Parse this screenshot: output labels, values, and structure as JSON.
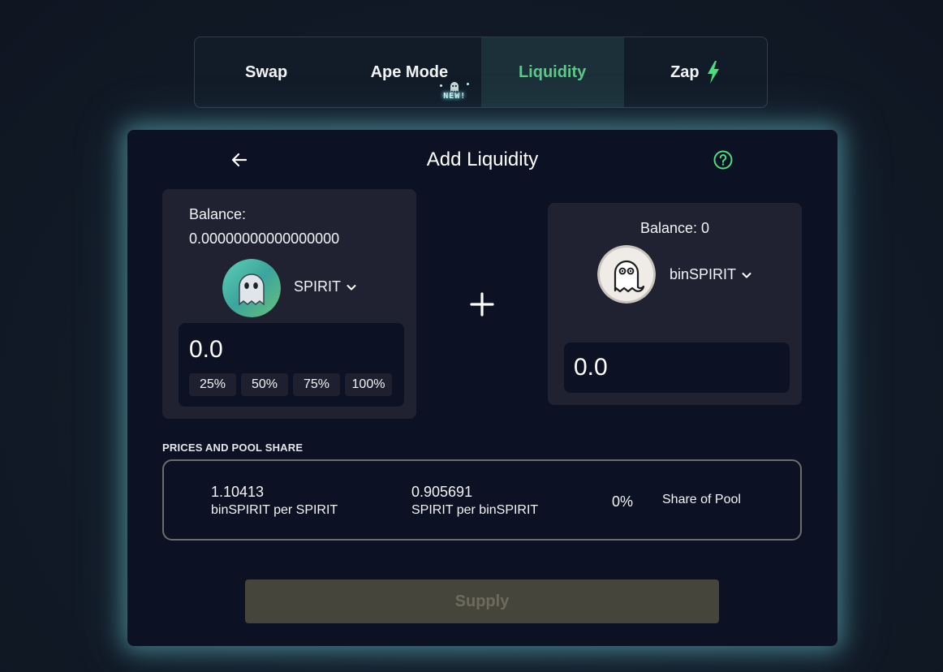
{
  "tabs": [
    {
      "label": "Swap"
    },
    {
      "label": "Ape Mode",
      "badge": "NEW!"
    },
    {
      "label": "Liquidity",
      "active": true
    },
    {
      "label": "Zap"
    }
  ],
  "card": {
    "title": "Add Liquidity"
  },
  "token_a": {
    "balance_label": "Balance:",
    "balance_value": "0.00000000000000000",
    "name": "SPIRIT",
    "amount": "0.0",
    "percent_buttons": [
      "25%",
      "50%",
      "75%",
      "100%"
    ]
  },
  "token_b": {
    "balance_label": "Balance: 0",
    "name": "binSPIRIT",
    "amount": "0.0"
  },
  "prices": {
    "heading": "PRICES AND POOL SHARE",
    "rate_1_value": "1.10413",
    "rate_1_label": "binSPIRIT per SPIRIT",
    "rate_2_value": "0.905691",
    "rate_2_label": "SPIRIT per binSPIRIT",
    "share_value": "0%",
    "share_label": "Share of Pool"
  },
  "supply_label": "Supply",
  "colors": {
    "accent_green": "#60c78b",
    "card_bg": "#0d1124",
    "panel_bg": "#202232",
    "glow": "#66bac4",
    "supply_disabled": "#46453b"
  },
  "icons": {
    "back": "arrow-left-icon",
    "help": "question-circle-icon",
    "plus": "plus-icon",
    "zap": "lightning-bolt-icon",
    "chevron": "chevron-down-icon"
  }
}
